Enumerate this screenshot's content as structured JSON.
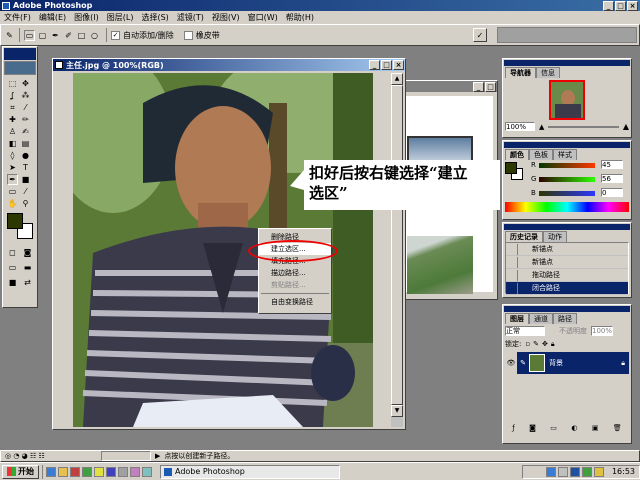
{
  "app": {
    "title": "Adobe Photoshop"
  },
  "menu": [
    "文件(F)",
    "编辑(E)",
    "图像(I)",
    "图层(L)",
    "选择(S)",
    "滤镜(T)",
    "视图(V)",
    "窗口(W)",
    "帮助(H)"
  ],
  "options": {
    "auto_add_delete": "自动添加/删除",
    "rubber_band": "橡皮带"
  },
  "doc": {
    "title": "主任.jpg @ 100%(RGB)"
  },
  "annotation": {
    "line1": "扣好后按右键选择“建立",
    "line2": "选区”"
  },
  "context_menu": {
    "items": [
      "删除路径",
      "建立选区...",
      "填充路径...",
      "描边路径...",
      "剪贴路径...",
      "自由变换路径"
    ]
  },
  "navigator": {
    "tabs": [
      "导航器",
      "信息"
    ],
    "zoom": "100%"
  },
  "color": {
    "tabs": [
      "颜色",
      "色板",
      "样式"
    ],
    "r": "45",
    "g": "56",
    "b": "0",
    "r_label": "R",
    "g_label": "G",
    "b_label": "B"
  },
  "history": {
    "tabs": [
      "历史记录",
      "动作"
    ],
    "items": [
      "新锚点",
      "新锚点",
      "拖动路径",
      "闭合路径"
    ]
  },
  "layers": {
    "tabs": [
      "图层",
      "通道",
      "路径"
    ],
    "mode": "正常",
    "opacity_label": "不透明度",
    "opacity": "100%",
    "lock_label": "锁定:",
    "layer_name": "背景"
  },
  "status": {
    "text": "点按以创建新子路径。"
  },
  "taskbar": {
    "start": "开始",
    "task": "Adobe Photoshop",
    "time": "16:53"
  },
  "colors": {
    "titlebar": "#0a246a",
    "fg_swatch": "#2d3800",
    "highlight": "#0a246a",
    "taskbar": "#d4d0c8"
  }
}
